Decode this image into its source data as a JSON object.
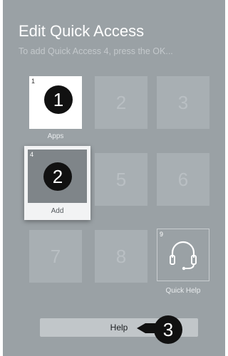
{
  "header": {
    "title": "Edit Quick Access",
    "subtitle": "To add Quick Access 4, press the OK..."
  },
  "tiles": [
    {
      "number": "1",
      "label": "Apps",
      "state": "app"
    },
    {
      "number": "2",
      "label": "",
      "state": "empty"
    },
    {
      "number": "3",
      "label": "",
      "state": "empty"
    },
    {
      "number": "4",
      "label": "Add",
      "state": "selected"
    },
    {
      "number": "5",
      "label": "",
      "state": "empty"
    },
    {
      "number": "6",
      "label": "",
      "state": "empty"
    },
    {
      "number": "7",
      "label": "",
      "state": "empty"
    },
    {
      "number": "8",
      "label": "",
      "state": "empty"
    },
    {
      "number": "9",
      "label": "Quick Help",
      "state": "app",
      "icon": "headset-icon"
    }
  ],
  "help": {
    "label": "Help"
  },
  "callouts": [
    "1",
    "2",
    "3"
  ],
  "colors": {
    "panel": "#9aa1a5",
    "tile": "#a8afb3",
    "marker": "#111111"
  }
}
